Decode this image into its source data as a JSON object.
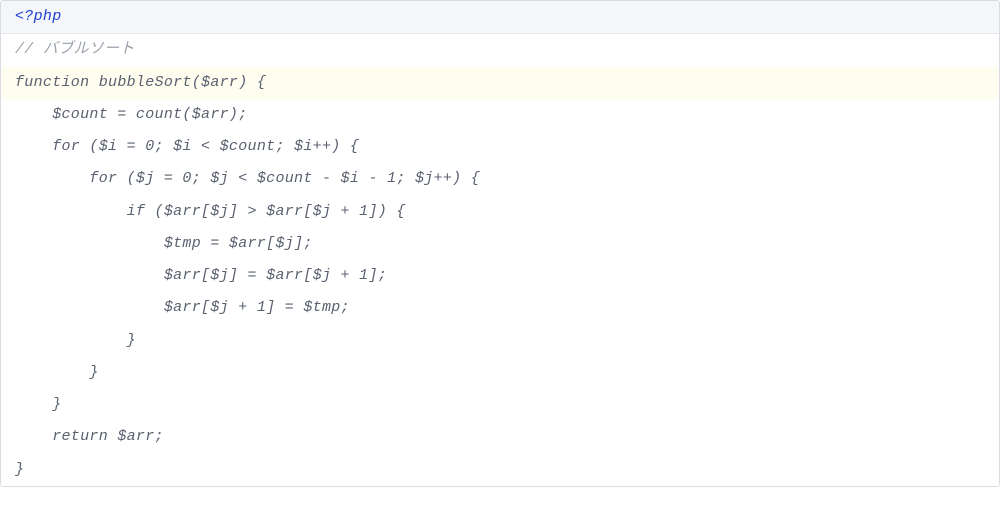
{
  "code": {
    "l1": "<?php",
    "l2": "// バブルソート",
    "l3": "function bubbleSort($arr) {",
    "l4": "    $count = count($arr);",
    "l5": "    for ($i = 0; $i < $count; $i++) {",
    "l6": "        for ($j = 0; $j < $count - $i - 1; $j++) {",
    "l7": "            if ($arr[$j] > $arr[$j + 1]) {",
    "l8": "                $tmp = $arr[$j];",
    "l9": "                $arr[$j] = $arr[$j + 1];",
    "l10": "                $arr[$j + 1] = $tmp;",
    "l11": "            }",
    "l12": "        }",
    "l13": "    }",
    "l14": "    return $arr;",
    "l15": "}"
  }
}
